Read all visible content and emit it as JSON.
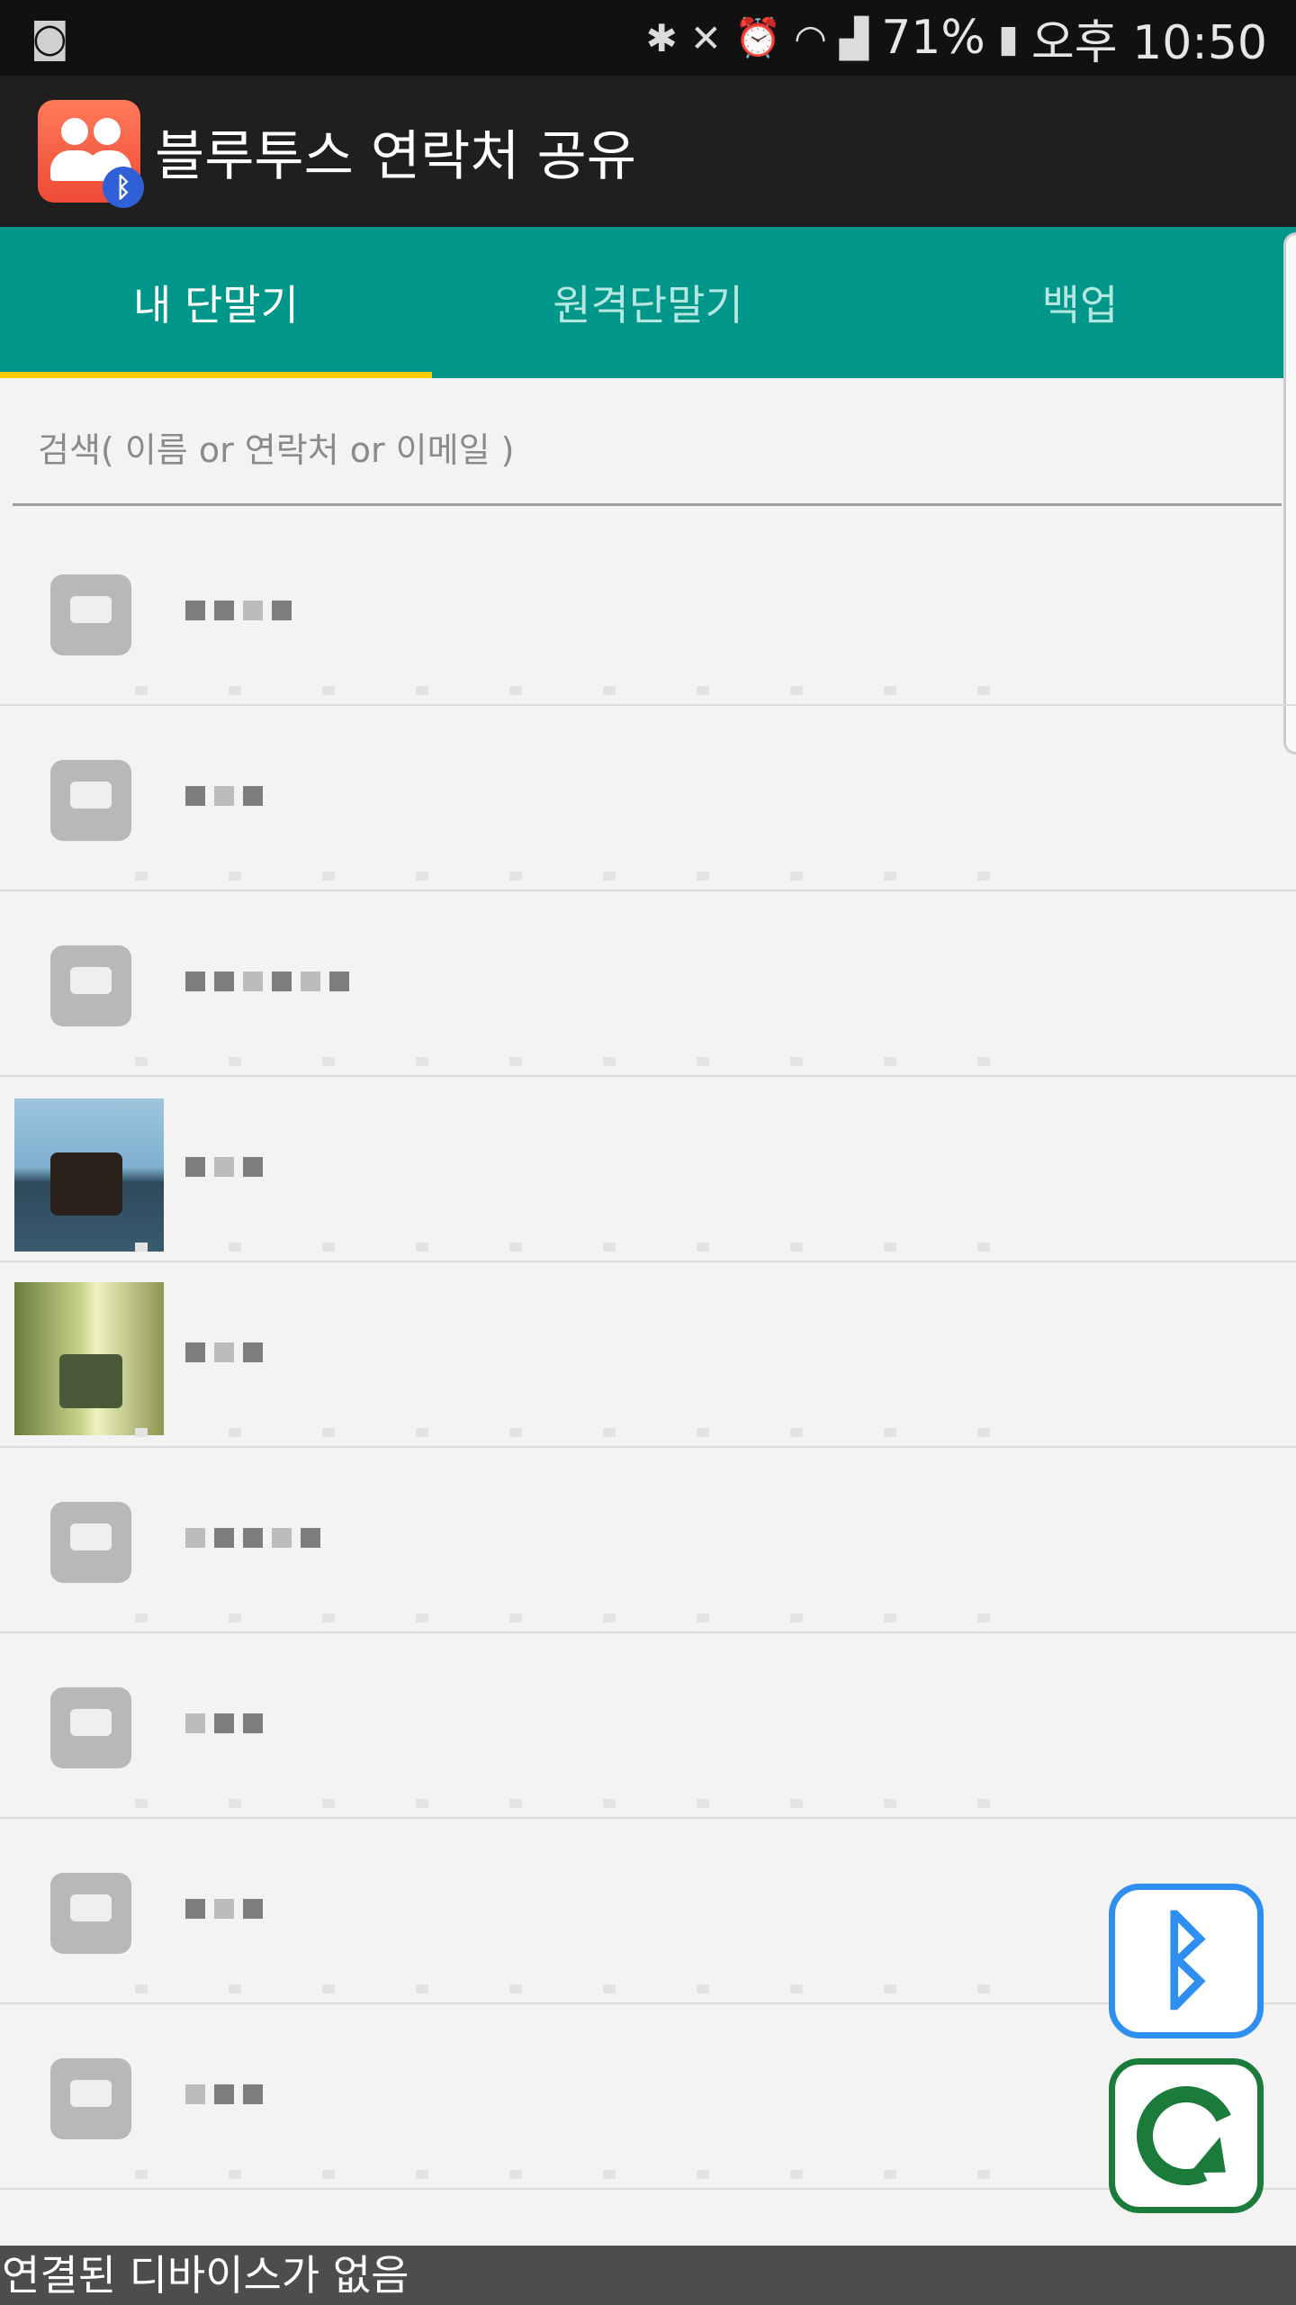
{
  "status_bar": {
    "battery": "71%",
    "time": "오후 10:50",
    "icons": [
      "app-notification-icon",
      "bluetooth-icon",
      "mute-icon",
      "alarm-icon",
      "wifi-icon",
      "signal-icon",
      "battery-icon"
    ]
  },
  "app_bar": {
    "title": "블루투스 연락처 공유",
    "icon": "contacts-bluetooth-app-icon"
  },
  "tabs": [
    {
      "label": "내 단말기",
      "active": true
    },
    {
      "label": "원격단말기",
      "active": false
    },
    {
      "label": "백업",
      "active": false
    }
  ],
  "search": {
    "placeholder": "검색( 이름 or 연락처 or 이메일 )",
    "value": ""
  },
  "contacts": [
    {
      "avatar": "default-contact-icon"
    },
    {
      "avatar": "default-contact-icon"
    },
    {
      "avatar": "default-contact-icon"
    },
    {
      "avatar": "photo"
    },
    {
      "avatar": "photo"
    },
    {
      "avatar": "default-contact-icon"
    },
    {
      "avatar": "default-contact-icon"
    },
    {
      "avatar": "default-contact-icon"
    },
    {
      "avatar": "default-contact-icon"
    }
  ],
  "fabs": {
    "bluetooth": "bluetooth-icon",
    "sync": "sync-icon"
  },
  "footer": {
    "status": "연결된 디바이스가 없음"
  },
  "colors": {
    "tab_bar": "#00968a",
    "tab_indicator": "#ffcc00",
    "app_bar": "#1f1f1f",
    "bluetooth_fab": "#2f8ff0",
    "sync_fab": "#1a7b3a"
  }
}
